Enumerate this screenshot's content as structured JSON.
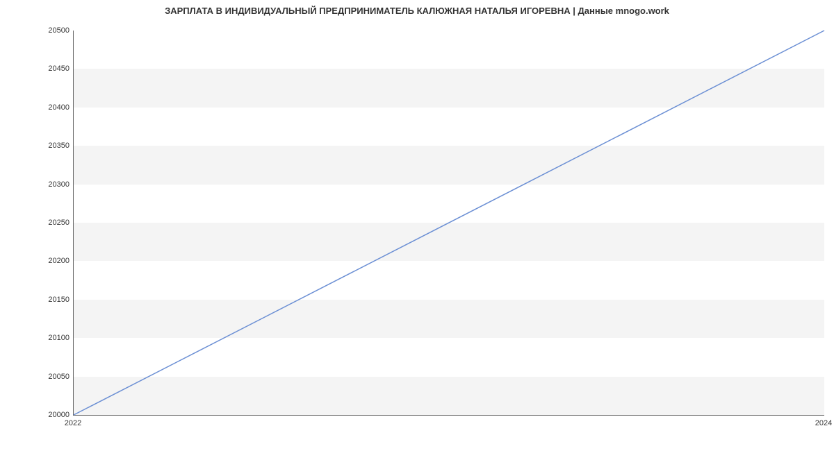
{
  "chart_data": {
    "type": "line",
    "title": "ЗАРПЛАТА В ИНДИВИДУАЛЬНЫЙ ПРЕДПРИНИМАТЕЛЬ КАЛЮЖНАЯ НАТАЛЬЯ ИГОРЕВНА | Данные mnogo.work",
    "xlabel": "",
    "ylabel": "",
    "x": [
      2022,
      2024
    ],
    "values": [
      20000,
      20500
    ],
    "x_ticks": [
      2022,
      2024
    ],
    "y_ticks": [
      20000,
      20050,
      20100,
      20150,
      20200,
      20250,
      20300,
      20350,
      20400,
      20450,
      20500
    ],
    "xlim": [
      2022,
      2024
    ],
    "ylim": [
      20000,
      20500
    ],
    "line_color": "#6b8fd4",
    "grid_bands": true
  }
}
